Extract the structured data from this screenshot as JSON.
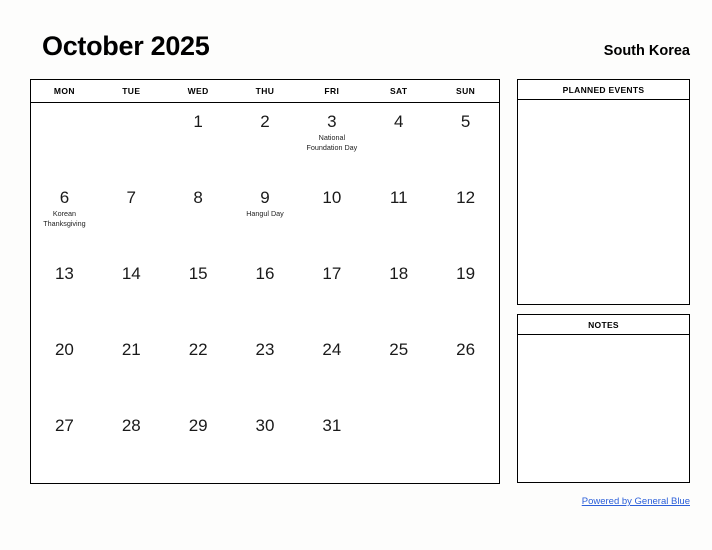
{
  "header": {
    "title": "October 2025",
    "region": "South Korea"
  },
  "calendar": {
    "weekdays": [
      "MON",
      "TUE",
      "WED",
      "THU",
      "FRI",
      "SAT",
      "SUN"
    ],
    "weeks": [
      [
        {
          "day": "",
          "event": ""
        },
        {
          "day": "",
          "event": ""
        },
        {
          "day": "1",
          "event": ""
        },
        {
          "day": "2",
          "event": ""
        },
        {
          "day": "3",
          "event": "National Foundation Day"
        },
        {
          "day": "4",
          "event": ""
        },
        {
          "day": "5",
          "event": ""
        }
      ],
      [
        {
          "day": "6",
          "event": "Korean Thanksgiving"
        },
        {
          "day": "7",
          "event": ""
        },
        {
          "day": "8",
          "event": ""
        },
        {
          "day": "9",
          "event": "Hangul Day"
        },
        {
          "day": "10",
          "event": ""
        },
        {
          "day": "11",
          "event": ""
        },
        {
          "day": "12",
          "event": ""
        }
      ],
      [
        {
          "day": "13",
          "event": ""
        },
        {
          "day": "14",
          "event": ""
        },
        {
          "day": "15",
          "event": ""
        },
        {
          "day": "16",
          "event": ""
        },
        {
          "day": "17",
          "event": ""
        },
        {
          "day": "18",
          "event": ""
        },
        {
          "day": "19",
          "event": ""
        }
      ],
      [
        {
          "day": "20",
          "event": ""
        },
        {
          "day": "21",
          "event": ""
        },
        {
          "day": "22",
          "event": ""
        },
        {
          "day": "23",
          "event": ""
        },
        {
          "day": "24",
          "event": ""
        },
        {
          "day": "25",
          "event": ""
        },
        {
          "day": "26",
          "event": ""
        }
      ],
      [
        {
          "day": "27",
          "event": ""
        },
        {
          "day": "28",
          "event": ""
        },
        {
          "day": "29",
          "event": ""
        },
        {
          "day": "30",
          "event": ""
        },
        {
          "day": "31",
          "event": ""
        },
        {
          "day": "",
          "event": ""
        },
        {
          "day": "",
          "event": ""
        }
      ]
    ]
  },
  "side_panels": {
    "planned_events_title": "PLANNED EVENTS",
    "notes_title": "NOTES"
  },
  "footer": {
    "link_text": "Powered by General Blue"
  },
  "colors": {
    "link": "#2b5fd9",
    "border": "#000000",
    "background": "#fdfdfc",
    "text": "#111111"
  }
}
